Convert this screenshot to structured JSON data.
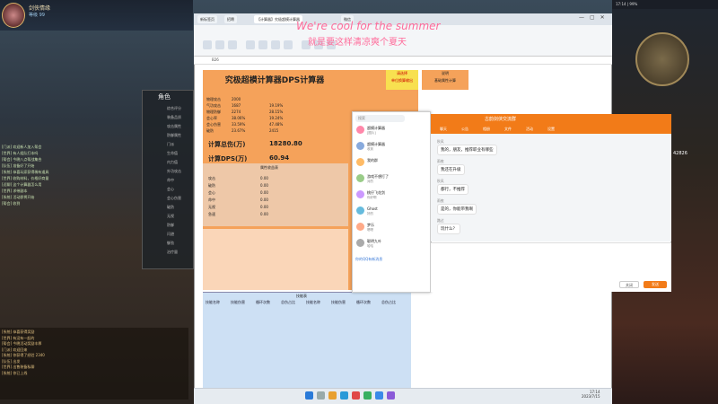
{
  "overlay": {
    "title_line1": "We're cool for the summer",
    "title_line2": "就是要这样清凉爽个夏天"
  },
  "game": {
    "player_name": "剑侠情缘",
    "player_level": "等级 99",
    "panel_title": "角色",
    "panel_items": [
      "综合评分",
      "装备品质",
      "攻击属性",
      "防御属性",
      "门派",
      "生命值",
      "内力值",
      "外功攻击",
      "命中",
      "会心",
      "会心伤害",
      "破防",
      "无视",
      "防御",
      "闪避",
      "御劲",
      "治疗量"
    ],
    "chat": [
      "[门派] 欢迎新人加入帮会",
      "[世界] 有人组队打本吗",
      "[帮会] 今晚八点帮战集合",
      "[队伍] 准备好了开始",
      "[系统] 恭喜玩家获得稀有道具",
      "[世界] 收购材料，价格好商量",
      "[近聊] 这个计算器怎么用",
      "[世界] 求带副本",
      "[系统] 活动即将开始",
      "[帮会] 收到"
    ],
    "chat2": [
      "[系统] 恭喜获得奖励",
      "[世界] 有没有一起的",
      "[帮会] 今晚活动奖励丰厚",
      "[门派] 欢迎回来",
      "[系统] 你获得了经验 2340",
      "[队伍] 出发",
      "[世界] 出售装备私聊",
      "[系统] 你已上线"
    ],
    "right_score": "42826"
  },
  "browser": {
    "tabs": [
      "新标签页",
      "招聘",
      "【计算器】究极超模计算器",
      "微信"
    ],
    "cell_ref": "B26",
    "sheet": {
      "title": "究极超模计算器DPS计算器",
      "box1_lines": [
        "请选择",
        "单位换算输出"
      ],
      "box2_lines": [
        "说明",
        "基础属性计算"
      ],
      "rows": [
        [
          "物理攻击",
          "2000"
        ],
        [
          "气功攻击",
          "1687"
        ],
        [
          "物理防御",
          "2274"
        ],
        [
          "会心率",
          "38.06%"
        ],
        [
          "会心伤害",
          "33.59%"
        ],
        [
          "破防",
          "23.67%"
        ]
      ],
      "mid_vals": [
        "19.19%",
        "28.15%",
        "19.24%",
        "47.48%",
        "2415"
      ],
      "damage_label": "计算总伤(万)",
      "damage_value": "18280.80",
      "dps_label": "计算DPS(万)",
      "dps_value": "60.94",
      "sub_title": "属性收益表",
      "left_labels": [
        "攻击",
        "破防",
        "会心",
        "命中",
        "无视",
        "急速"
      ],
      "zero_vals": [
        "0.00",
        "0.00",
        "0.00",
        "0.00",
        "0.00",
        "0.00"
      ],
      "blue_header": "技能表",
      "blue_cols": [
        "技能名称",
        "技能伤害",
        "循环次数",
        "总伤占比",
        "技能名称",
        "技能伤害",
        "循环次数",
        "总伤占比"
      ]
    }
  },
  "qq": {
    "search_placeholder": "搜索",
    "items": [
      {
        "name": "超模计算器",
        "msg": "[图片]"
      },
      {
        "name": "超模计算器",
        "msg": "收到"
      },
      {
        "name": "我的群",
        "msg": ""
      },
      {
        "name": "游戏不想打了",
        "msg": "对的"
      },
      {
        "name": "桃仔飞花剑",
        "msg": "你好啊"
      },
      {
        "name": "Ghost",
        "msg": "好的"
      },
      {
        "name": "梦乐",
        "msg": "嗯嗯"
      },
      {
        "name": "聪明九叶",
        "msg": "哈哈"
      }
    ],
    "footer": "你的QQ有新消息"
  },
  "group": {
    "title": "古韵剑侠交流群",
    "tabs": [
      "聊天",
      "公告",
      "相册",
      "文件",
      "活动",
      "设置"
    ],
    "messages": [
      {
        "sender": "秋风",
        "text": "我的，朋友，推荐职业有哪些"
      },
      {
        "sender": "雨夜",
        "text": "我还在升级"
      },
      {
        "sender": "秋风",
        "text": "都行，不推荐"
      },
      {
        "sender": "雨夜",
        "text": "是的，你能带我啊"
      },
      {
        "sender": "路过",
        "text": "玩什么？"
      }
    ],
    "close_label": "关闭",
    "send_label": "发送"
  },
  "taskbar": {
    "time": "17:14",
    "date": "2023/7/15"
  },
  "os": {
    "top_text": "17:14 | 99%"
  }
}
